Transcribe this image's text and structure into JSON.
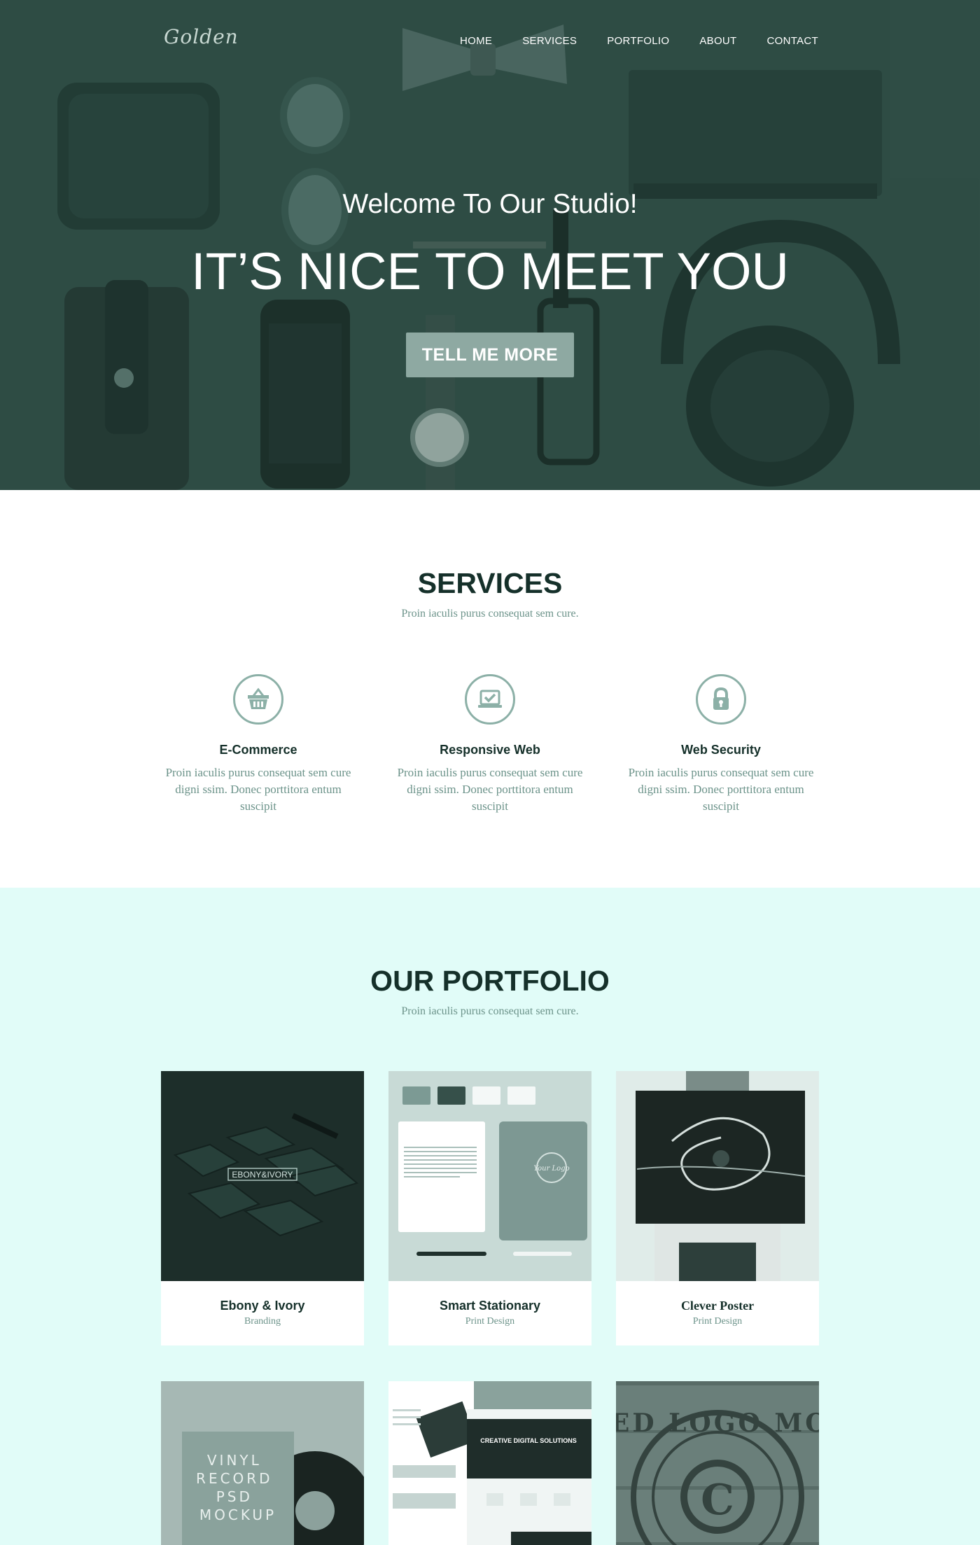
{
  "nav": {
    "logo": "Golden",
    "items": [
      {
        "label": "HOME"
      },
      {
        "label": "SERVICES"
      },
      {
        "label": "PORTFOLIO"
      },
      {
        "label": "ABOUT"
      },
      {
        "label": "CONTACT"
      }
    ]
  },
  "hero": {
    "subtitle": "Welcome To Our Studio!",
    "title": "IT’S NICE TO MEET YOU",
    "button": "TELL ME MORE"
  },
  "services": {
    "title": "SERVICES",
    "subtitle": "Proin iaculis purus consequat sem cure.",
    "items": [
      {
        "icon": "basket-icon",
        "title": "E-Commerce",
        "text": "Proin iaculis purus consequat sem cure digni ssim. Donec porttitora entum suscipit"
      },
      {
        "icon": "laptop-check-icon",
        "title": "Responsive Web",
        "text": "Proin iaculis purus consequat sem cure digni ssim. Donec porttitora entum suscipit"
      },
      {
        "icon": "lock-icon",
        "title": "Web Security",
        "text": "Proin iaculis purus consequat sem cure digni ssim. Donec porttitora entum suscipit"
      }
    ]
  },
  "portfolio": {
    "title": "OUR PORTFOLIO",
    "subtitle": "Proin iaculis purus consequat sem cure.",
    "items": [
      {
        "title": "Ebony & Ivory",
        "category": "Branding",
        "image_text": "EBONY&IVORY"
      },
      {
        "title": "Smart Stationary",
        "category": "Print Design",
        "image_text": "Your Logo"
      },
      {
        "title": "Clever Poster",
        "category": "Print Design"
      },
      {
        "image_text": "VINYL RECORD PSD MOCKUP"
      },
      {
        "image_text": "CREATIVE DIGITAL SOLUTIONS"
      },
      {
        "image_text": "BURNED LOGO MOCKUP"
      }
    ]
  },
  "colors": {
    "hero_tint": "#2d4a43",
    "accent": "#8ea9a2",
    "heading": "#15302a",
    "muted_text": "#6c938a",
    "portfolio_bg": "#e1fcf8"
  }
}
